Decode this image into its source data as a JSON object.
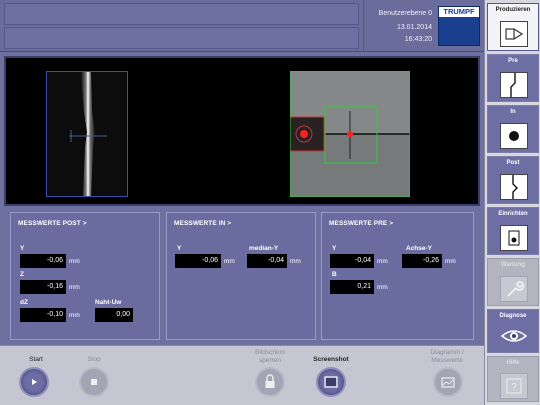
{
  "header": {
    "user_level": "Benutzerebene 0",
    "date": "13.01.2014",
    "time": "16:43:20",
    "logo_text": "TRUMPF"
  },
  "panels": {
    "post": {
      "title": "MESSWERTE POST >",
      "y_label": "Y",
      "y_value": "-0,06",
      "y_unit": "mm",
      "z_label": "Z",
      "z_value": "-0,16",
      "z_unit": "mm",
      "dz_label": "dZ",
      "dz_value": "-0,10",
      "dz_unit": "mm",
      "naht_label": "Naht-Uw",
      "naht_value": "0,00"
    },
    "in": {
      "title": "MESSWERTE IN >",
      "y_label": "Y",
      "y_value": "-0,06",
      "y_unit": "mm",
      "median_label": "median-Y",
      "median_value": "-0,04",
      "median_unit": "mm"
    },
    "pre": {
      "title": "MESSWERTE PRE >",
      "y_label": "Y",
      "y_value": "-0,04",
      "y_unit": "mm",
      "achse_label": "Achse-Y",
      "achse_value": "-0,26",
      "achse_unit": "mm",
      "b_label": "B",
      "b_value": "0,21",
      "b_unit": "mm"
    }
  },
  "bottom": {
    "start": "Start",
    "stop": "Stop",
    "lock": "Bildschirm sperren",
    "screenshot": "Screenshot",
    "diagram": "Diagramm / Messwerte"
  },
  "sidebar": {
    "items": [
      {
        "label": "Produzieren",
        "icon": "produce-icon"
      },
      {
        "label": "Pre",
        "icon": "pre-weld-icon"
      },
      {
        "label": "In",
        "icon": "in-weld-icon"
      },
      {
        "label": "Post",
        "icon": "post-weld-icon"
      },
      {
        "label": "Einrichten",
        "icon": "setup-icon"
      },
      {
        "label": "Wartung",
        "icon": "wrench-icon"
      },
      {
        "label": "Diagnose",
        "icon": "eye-icon"
      },
      {
        "label": "Hilfe",
        "icon": "help-icon"
      }
    ]
  },
  "colors": {
    "background": "#6e709f",
    "panel": "#6a6c9f",
    "logo_blue": "#1a3f8f",
    "marker_red": "#ff2020",
    "roi_green": "#2ecc40",
    "roi_blue": "#3b4fb0"
  }
}
